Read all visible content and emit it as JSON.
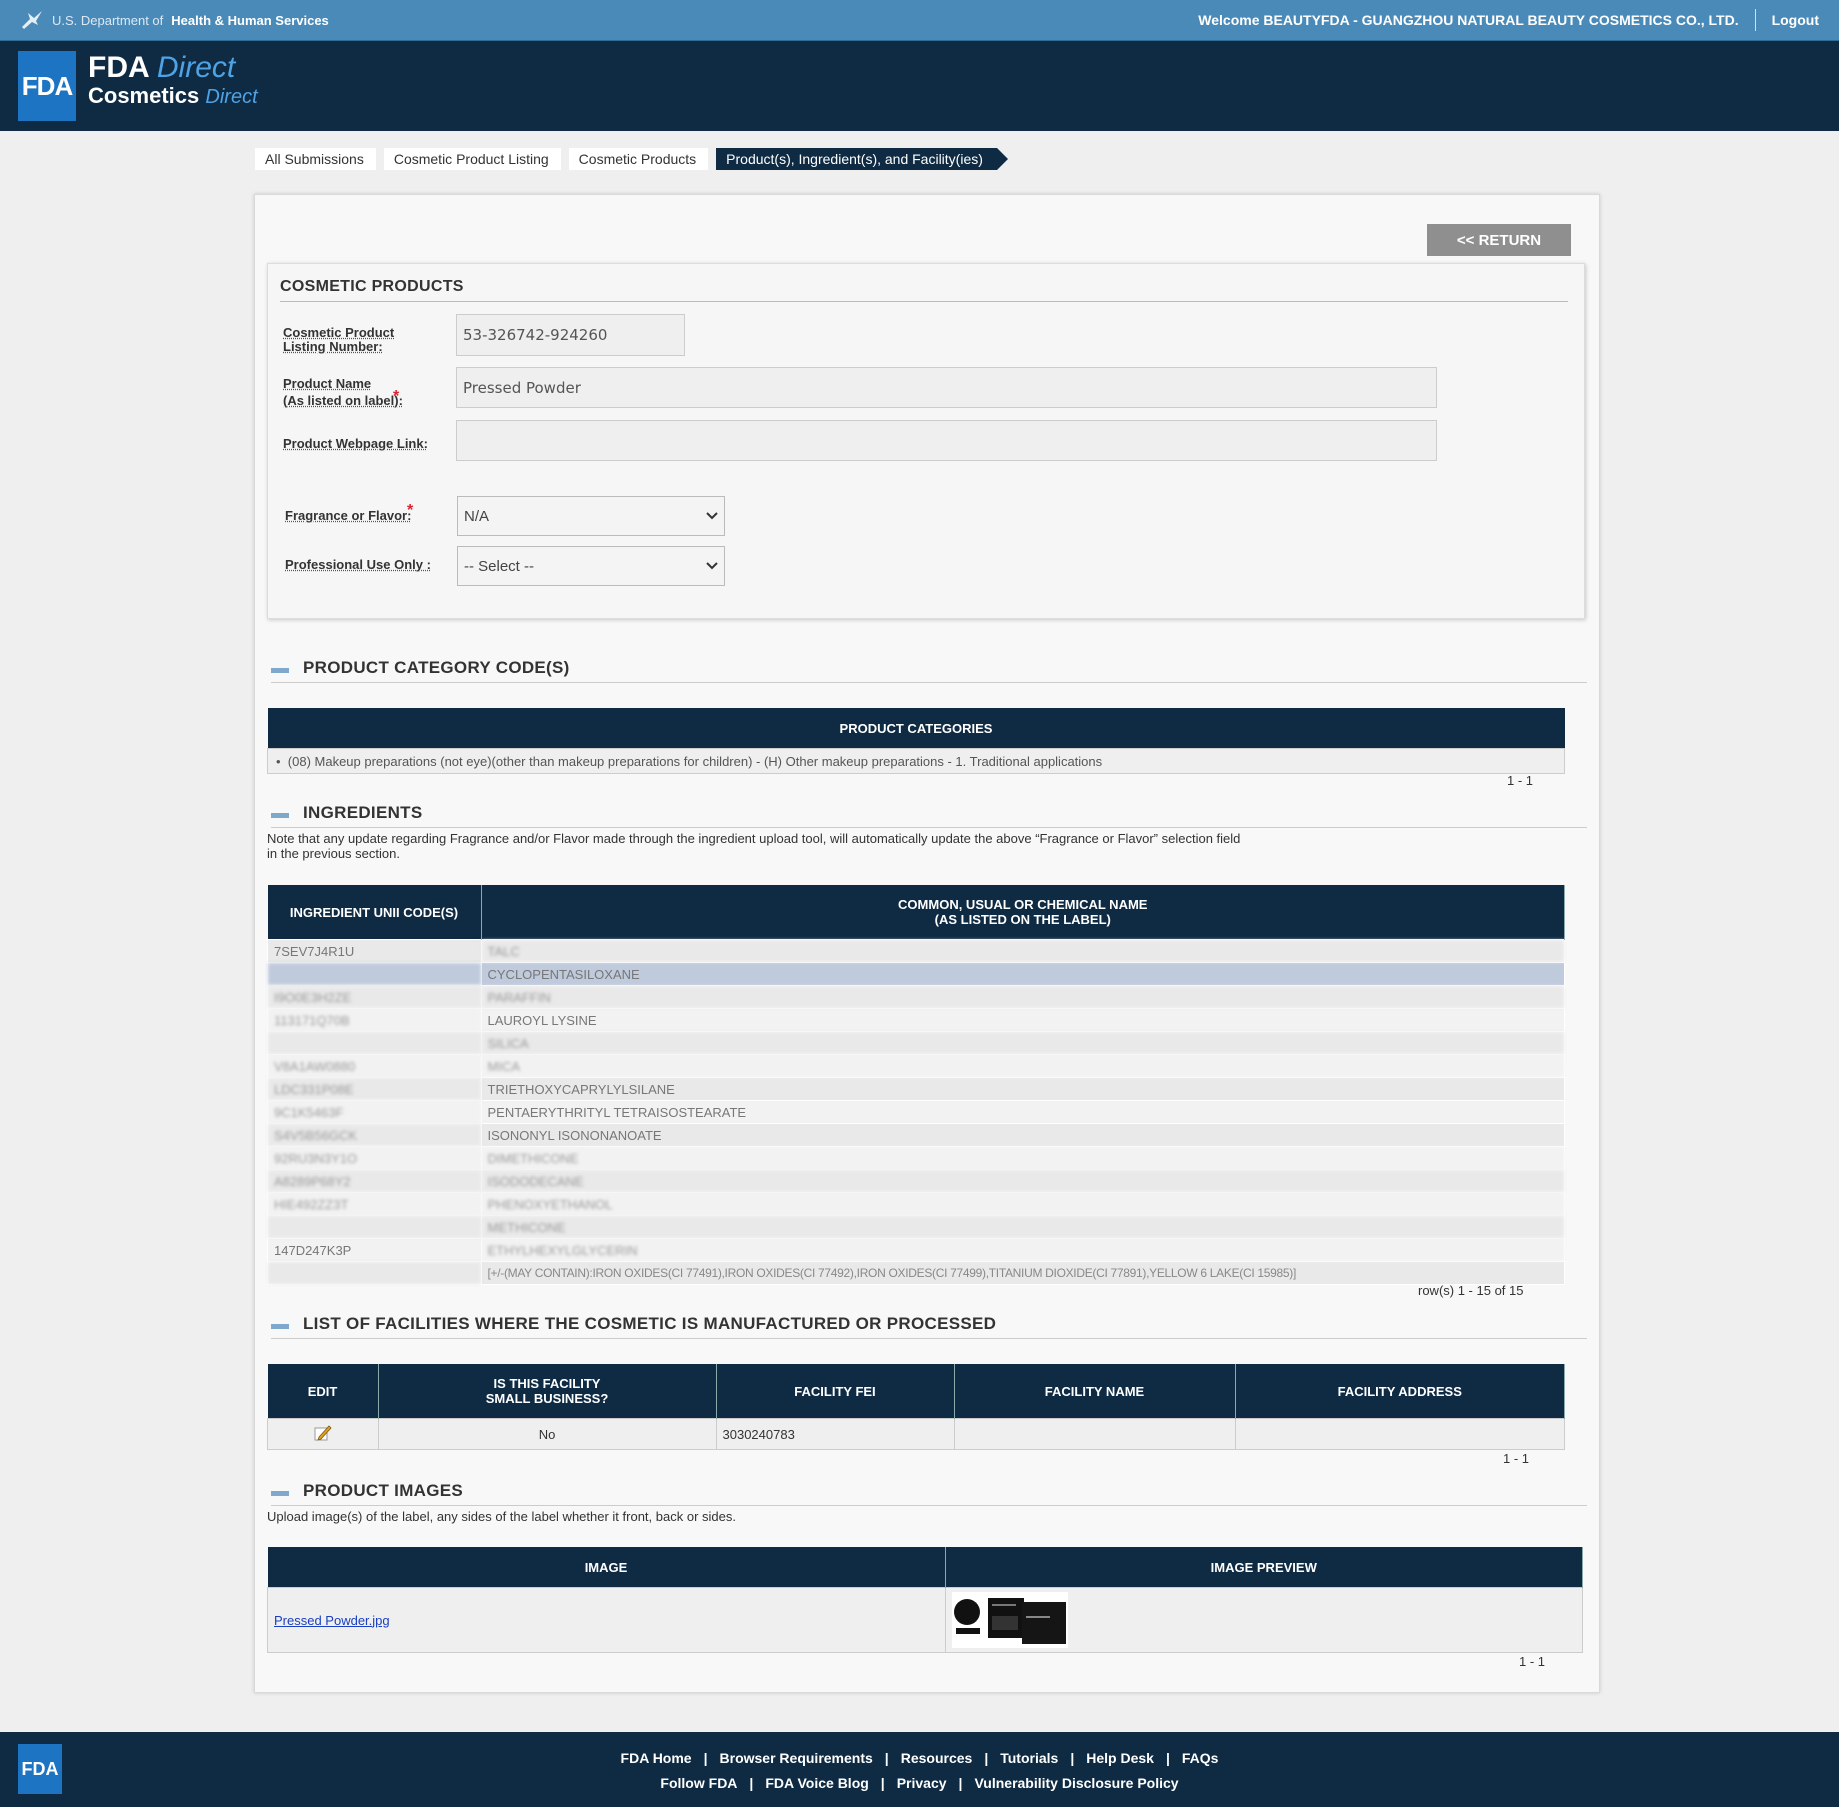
{
  "top_bar": {
    "dept_prefix": "U.S. Department of",
    "dept_bold": "Health & Human Services",
    "welcome": "Welcome BEAUTYFDA - GUANGZHOU NATURAL BEAUTY COSMETICS CO., LTD.",
    "logout": "Logout"
  },
  "header": {
    "logo": "FDA",
    "line1_bold": "FDA",
    "line1_italic": "Direct",
    "line2_bold": "Cosmetics",
    "line2_italic": "Direct"
  },
  "breadcrumb": [
    "All Submissions",
    "Cosmetic Product Listing",
    "Cosmetic Products",
    "Product(s), Ingredient(s), and Facility(ies)"
  ],
  "return_label": "<< RETURN",
  "cosmetic_products": {
    "title": "COSMETIC PRODUCTS",
    "listing_label_1": "Cosmetic Product",
    "listing_label_2": "Listing Number:",
    "listing_value": "53-326742-924260",
    "name_label_1": "Product Name",
    "name_label_2": "(As listed on label):",
    "name_value": "Pressed Powder",
    "webpage_label": "Product Webpage Link:",
    "webpage_value": "",
    "fragrance_label": "Fragrance or Flavor:",
    "fragrance_value": "N/A",
    "pro_label": "Professional Use Only :",
    "pro_value": "-- Select --",
    "required_mark": "*"
  },
  "category_section": {
    "title": "PRODUCT CATEGORY CODE(S)",
    "header": "PRODUCT CATEGORIES",
    "item": "(08) Makeup preparations (not eye)(other than makeup preparations for children) - (H) Other makeup preparations - 1. Traditional applications",
    "pager": "1 - 1"
  },
  "ingredients": {
    "title": "INGREDIENTS",
    "note_1": "Note that any update regarding Fragrance and/or Flavor made through the ingredient upload tool, will automatically update the above “Fragrance or Flavor” selection field",
    "note_2": "in the previous section.",
    "col1": "INGREDIENT UNII CODE(S)",
    "col2_1": "COMMON, USUAL OR CHEMICAL NAME",
    "col2_2": "(AS LISTED ON THE LABEL)",
    "rows": [
      {
        "code": "7SEV7J4R1U",
        "name": "TALC"
      },
      {
        "code": "",
        "name": "CYCLOPENTASILOXANE"
      },
      {
        "code": "I9O0E3H2ZE",
        "name": "PARAFFIN"
      },
      {
        "code": "113171Q70B",
        "name": "LAUROYL LYSINE"
      },
      {
        "code": "",
        "name": "SILICA"
      },
      {
        "code": "V8A1AW0880",
        "name": "MICA"
      },
      {
        "code": "LDC331P08E",
        "name": "TRIETHOXYCAPRYLYLSILANE"
      },
      {
        "code": "9C1K5463F",
        "name": "PENTAERYTHRITYL TETRAISOSTEARATE"
      },
      {
        "code": "S4V5B56GCK",
        "name": "ISONONYL ISONONANOATE"
      },
      {
        "code": "92RU3N3Y1O",
        "name": "DIMETHICONE"
      },
      {
        "code": "A8289P68Y2",
        "name": "ISODODECANE"
      },
      {
        "code": "HIE492ZZ3T",
        "name": "PHENOXYETHANOL"
      },
      {
        "code": "",
        "name": "METHICONE"
      },
      {
        "code": "147D247K3P",
        "name": "ETHYLHEXYLGLYCERIN"
      },
      {
        "code": "",
        "name": "[+/-(MAY CONTAIN):IRON OXIDES(CI 77491),IRON OXIDES(CI 77492),IRON OXIDES(CI 77499),TITANIUM DIOXIDE(CI 77891),YELLOW 6 LAKE(CI 15985)]"
      }
    ],
    "pager": "row(s) 1 - 15 of 15"
  },
  "facilities": {
    "title": "LIST OF FACILITIES WHERE THE COSMETIC IS MANUFACTURED OR PROCESSED",
    "col_edit": "EDIT",
    "col_small_1": "IS THIS FACILITY",
    "col_small_2": "SMALL BUSINESS?",
    "col_fei": "FACILITY FEI",
    "col_name": "FACILITY NAME",
    "col_address": "FACILITY ADDRESS",
    "row_small": "No",
    "row_fei": "3030240783",
    "row_name": "",
    "row_address": "",
    "pager": "1 - 1"
  },
  "images": {
    "title": "PRODUCT IMAGES",
    "note": "Upload image(s) of the label, any sides of the label whether it front, back or sides.",
    "col_image": "IMAGE",
    "col_preview": "IMAGE PREVIEW",
    "file": "Pressed Powder.jpg",
    "pager": "1 - 1"
  },
  "footer": {
    "logo": "FDA",
    "row1": [
      "FDA Home",
      "Browser Requirements",
      "Resources",
      "Tutorials",
      "Help Desk",
      "FAQs"
    ],
    "row2": [
      "Follow FDA",
      "FDA Voice Blog",
      "Privacy",
      "Vulnerability Disclosure Policy"
    ],
    "separator": "|"
  }
}
